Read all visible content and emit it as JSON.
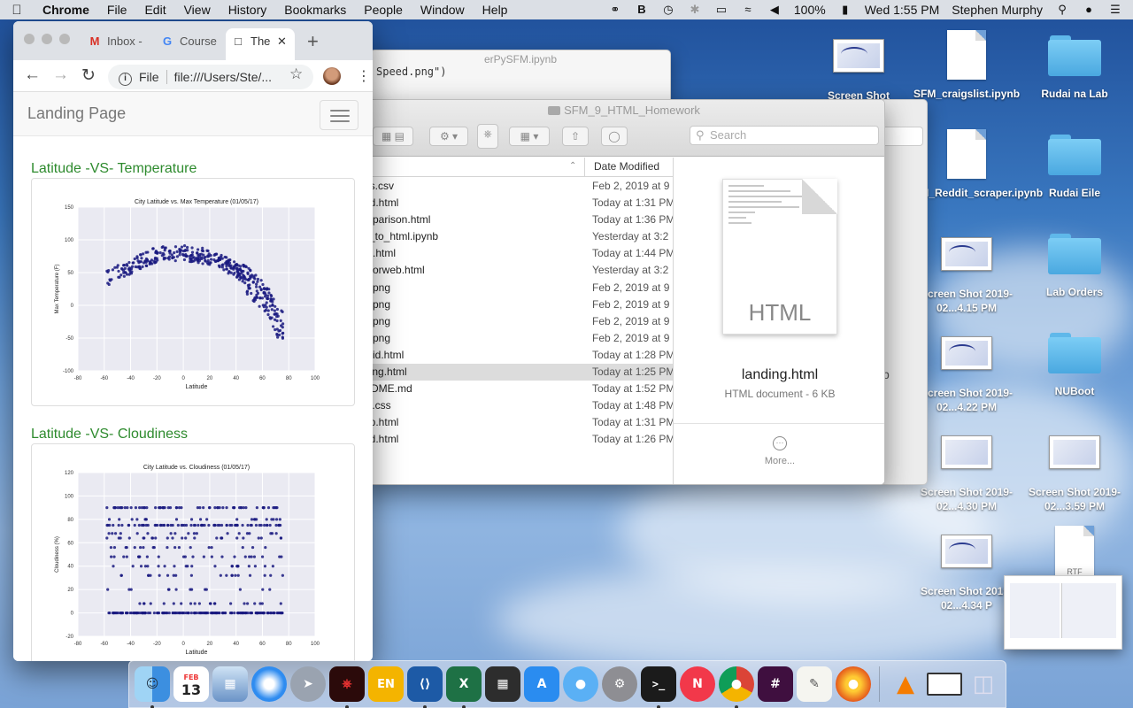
{
  "menubar": {
    "app": "Chrome",
    "items": [
      "File",
      "Edit",
      "View",
      "History",
      "Bookmarks",
      "People",
      "Window",
      "Help"
    ],
    "battery": "100%",
    "clock": "Wed 1:55 PM",
    "user": "Stephen Murphy"
  },
  "chrome": {
    "tabs": [
      {
        "label": "Inbox -",
        "icon": "gmail-icon"
      },
      {
        "label": "Course",
        "icon": "google-icon"
      },
      {
        "label": "The",
        "icon": "page-icon"
      }
    ],
    "omnibox_scheme": "File",
    "omnibox_url": "file:///Users/Ste/...",
    "page": {
      "brand": "Landing Page",
      "sections": [
        {
          "title": "Latitude -VS- Temperature"
        },
        {
          "title": "Latitude -VS- Cloudiness"
        }
      ]
    }
  },
  "chart_data": [
    {
      "type": "scatter",
      "title": "City Latitude vs. Max Temperature (01/05/17)",
      "xlabel": "Latitude",
      "ylabel": "Max Temperature (F)",
      "xlim": [
        -80,
        100
      ],
      "ylim": [
        -100,
        150
      ],
      "xticks": [
        -80,
        -60,
        -40,
        -20,
        0,
        20,
        40,
        60,
        80,
        100
      ],
      "yticks": [
        -100,
        -50,
        0,
        50,
        100,
        150
      ],
      "grid": true,
      "color": "#1a1a80",
      "trend": [
        [
          -60,
          40
        ],
        [
          -40,
          60
        ],
        [
          -20,
          78
        ],
        [
          0,
          80
        ],
        [
          20,
          74
        ],
        [
          40,
          55
        ],
        [
          55,
          25
        ],
        [
          65,
          5
        ],
        [
          72,
          -30
        ]
      ]
    },
    {
      "type": "scatter",
      "title": "City Latitude vs. Cloudiness (01/05/17)",
      "xlabel": "Latitude",
      "ylabel": "Cloudiness (%)",
      "xlim": [
        -80,
        100
      ],
      "ylim": [
        -20,
        120
      ],
      "xticks": [
        -80,
        -60,
        -40,
        -20,
        0,
        20,
        40,
        60,
        80,
        100
      ],
      "yticks": [
        -20,
        0,
        20,
        40,
        60,
        80,
        100,
        120
      ],
      "grid": true,
      "color": "#1a1a80",
      "levels": [
        0,
        8,
        20,
        32,
        40,
        48,
        56,
        64,
        68,
        75,
        80,
        90
      ]
    }
  ],
  "finder": {
    "title": "SFM_9_HTML_Homework",
    "search_placeholder": "Search",
    "column_date": "Date Modified",
    "rows": [
      {
        "name": "es.csv",
        "date": "Feb 2, 2019 at 9"
      },
      {
        "name": "ud.html",
        "date": "Today at 1:31 PM"
      },
      {
        "name": "mparison.html",
        "date": "Today at 1:36 PM"
      },
      {
        "name": "y_to_html.ipynb",
        "date": "Yesterday at 3:2"
      },
      {
        "name": "ta.html",
        "date": "Today at 1:44 PM"
      },
      {
        "name": "aforweb.html",
        "date": "Yesterday at 3:2"
      },
      {
        "name": "1.png",
        "date": "Feb 2, 2019 at 9"
      },
      {
        "name": "2.png",
        "date": "Feb 2, 2019 at 9"
      },
      {
        "name": "3.png",
        "date": "Feb 2, 2019 at 9"
      },
      {
        "name": "4.png",
        "date": "Feb 2, 2019 at 9"
      },
      {
        "name": "mid.html",
        "date": "Today at 1:28 PM"
      },
      {
        "name": "ding.html",
        "date": "Today at 1:25 PM",
        "selected": true
      },
      {
        "name": "ADME.md",
        "date": "Today at 1:52 PM"
      },
      {
        "name": "le.css",
        "date": "Today at 1:48 PM"
      },
      {
        "name": "np.html",
        "date": "Today at 1:31 PM"
      },
      {
        "name": "nd.html",
        "date": "Today at 1:26 PM"
      }
    ],
    "preview": {
      "doc_label": "HTML",
      "name": "landing.html",
      "kind": "HTML document - 6 KB",
      "more": "More..."
    }
  },
  "jupyter": {
    "title": "erPySFM.ipynb",
    "code": "Speed.png\")"
  },
  "desktop": [
    {
      "label": "Screen Shot",
      "kind": "shot"
    },
    {
      "label": "SFM_craigslist.ipynb",
      "kind": "doc"
    },
    {
      "label": "Rudai na Lab",
      "kind": "folder"
    },
    {
      "label": "FM_Reddit_scraper.ipynb",
      "kind": "doc"
    },
    {
      "label": "Rudai Eile",
      "kind": "folder"
    },
    {
      "label": "Screen Shot 2019-02...4.15 PM",
      "kind": "shot"
    },
    {
      "label": "Lab Orders",
      "kind": "folder"
    },
    {
      "label": "Screen Shot 2019-02...4.22 PM",
      "kind": "shot"
    },
    {
      "label": "NUBoot",
      "kind": "folder"
    },
    {
      "label": "Screen Shot 2019-02...4.30 PM",
      "kind": "shot"
    },
    {
      "label": "Screen Shot 2019-02...3.59 PM",
      "kind": "shot"
    },
    {
      "label": "Screen Shot 2019-02...4.34 P",
      "kind": "shot"
    },
    {
      "label": "RTF",
      "kind": "doc"
    }
  ],
  "dock_calendar": {
    "month": "FEB",
    "day": "13"
  },
  "dock_evernote": "EN"
}
